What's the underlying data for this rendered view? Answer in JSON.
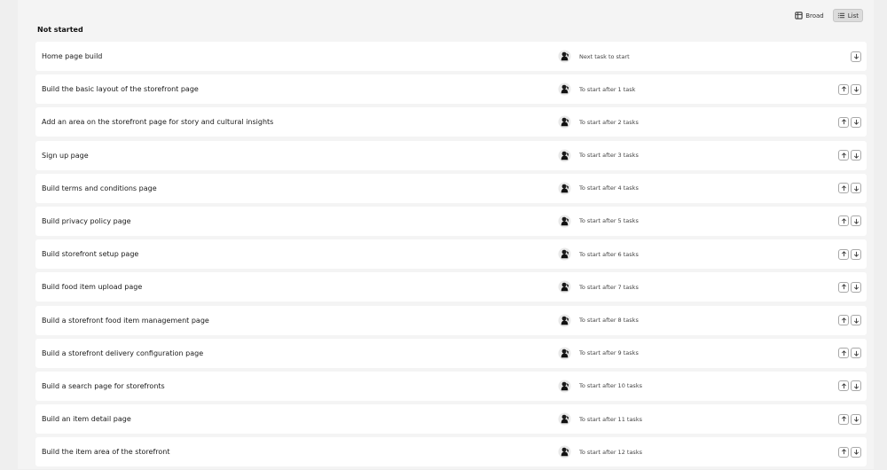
{
  "view": {
    "board_label": "Broad",
    "list_label": "List",
    "active": "list"
  },
  "section": {
    "title": "Not started"
  },
  "tasks": [
    {
      "name": "Home page build",
      "status": "Next task to start",
      "can_move_up": false
    },
    {
      "name": "Build the basic layout of the storefront page",
      "status": "To start after 1 task",
      "can_move_up": true
    },
    {
      "name": "Add an area on the storefront page for story and cultural insights",
      "status": "To start after 2 tasks",
      "can_move_up": true
    },
    {
      "name": "Sign up page",
      "status": "To start after 3 tasks",
      "can_move_up": true
    },
    {
      "name": "Build terms and conditions page",
      "status": "To start after 4 tasks",
      "can_move_up": true
    },
    {
      "name": "Build privacy policy page",
      "status": "To start after 5 tasks",
      "can_move_up": true
    },
    {
      "name": "Build storefront setup page",
      "status": "To start after 6 tasks",
      "can_move_up": true
    },
    {
      "name": "Build food item upload page",
      "status": "To start after 7 tasks",
      "can_move_up": true
    },
    {
      "name": "Build a storefront food item management page",
      "status": "To start after 8 tasks",
      "can_move_up": true
    },
    {
      "name": "Build a storefront delivery configuration page",
      "status": "To start after 9 tasks",
      "can_move_up": true
    },
    {
      "name": "Build a search page for storefronts",
      "status": "To start after 10 tasks",
      "can_move_up": true
    },
    {
      "name": "Build an item detail page",
      "status": "To start after 11 tasks",
      "can_move_up": true
    },
    {
      "name": "Build the item area of the storefront",
      "status": "To start after 12 tasks",
      "can_move_up": true
    }
  ],
  "icons": {
    "board": "board-icon",
    "list": "list-icon",
    "up": "arrow-up-icon",
    "down": "arrow-down-icon",
    "avatar": "avatar"
  }
}
